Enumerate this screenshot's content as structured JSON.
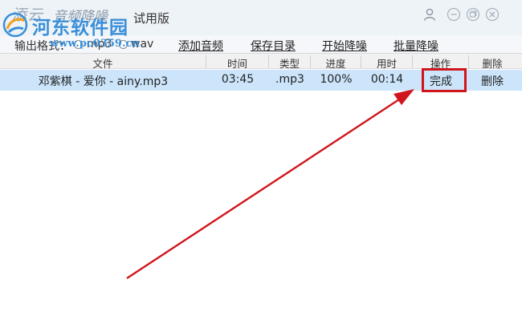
{
  "app": {
    "logo_text": "添云",
    "name": "音频降噪",
    "edition": "试用版"
  },
  "watermark": {
    "site_name": "河东软件园",
    "url": "www.pc0359.cn"
  },
  "window_controls": [
    "user-icon",
    "minimize-icon",
    "restore-icon",
    "close-icon"
  ],
  "toolbar": {
    "format_label": "输出格式：",
    "format_options": [
      "mp3",
      "wav"
    ],
    "add_audio": "添加音频",
    "save_dir": "保存目录",
    "start_denoise": "开始降噪",
    "batch_denoise": "批量降噪"
  },
  "table": {
    "columns": [
      "文件",
      "时间",
      "类型",
      "进度",
      "用时",
      "操作",
      "删除"
    ],
    "rows": [
      {
        "file": "邓紫棋 - 爱你 - ainy.mp3",
        "time": "03:45",
        "type": ".mp3",
        "progress": "100%",
        "elapsed": "00:14",
        "action": "完成",
        "delete": "删除"
      }
    ]
  },
  "colors": {
    "selected_row": "#cce5fb",
    "highlight": "#d0161c",
    "watermark": "#3a8fd8"
  }
}
